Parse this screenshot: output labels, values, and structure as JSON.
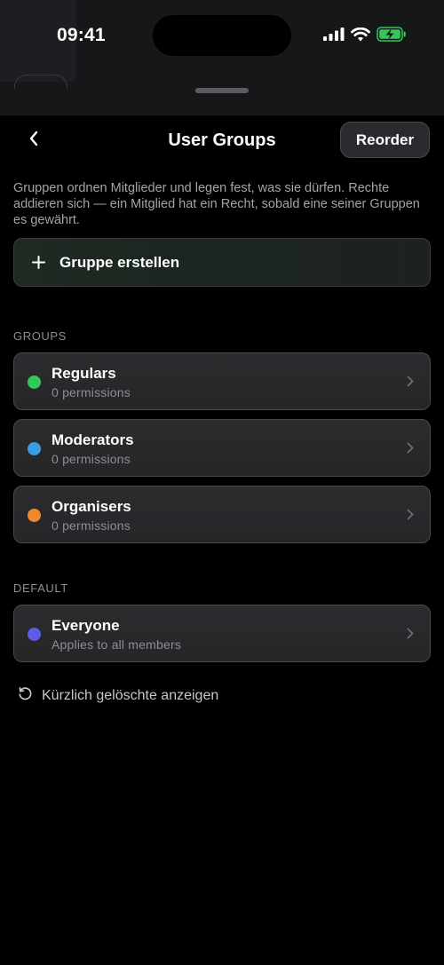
{
  "status_bar": {
    "time": "09:41"
  },
  "nav": {
    "title": "User Groups",
    "reorder_label": "Reorder"
  },
  "description": "Gruppen ordnen Mitglieder und legen fest, was sie dürfen. Rechte addieren sich — ein Mitglied hat ein Recht, sobald eine seiner Gruppen es gewährt.",
  "create_group": {
    "label": "Gruppe erstellen",
    "icon": "plus-icon"
  },
  "groups_section": {
    "label": "GROUPS",
    "items": [
      {
        "name": "Regulars",
        "subtitle": "0 permissions",
        "color": "#34c759"
      },
      {
        "name": "Moderators",
        "subtitle": "0 permissions",
        "color": "#3a9ee6"
      },
      {
        "name": "Organisers",
        "subtitle": "0 permissions",
        "color": "#f0892e"
      }
    ]
  },
  "default_section": {
    "label": "DEFAULT",
    "items": [
      {
        "name": "Everyone",
        "subtitle": "Applies to all members",
        "color": "#5e5ce6"
      }
    ]
  },
  "recently_deleted": {
    "label": "Kürzlich gelöschte anzeigen",
    "icon": "restore-icon"
  },
  "colors": {
    "battery": "#34c759",
    "background": "#000000",
    "card": "#2a2a2d"
  }
}
